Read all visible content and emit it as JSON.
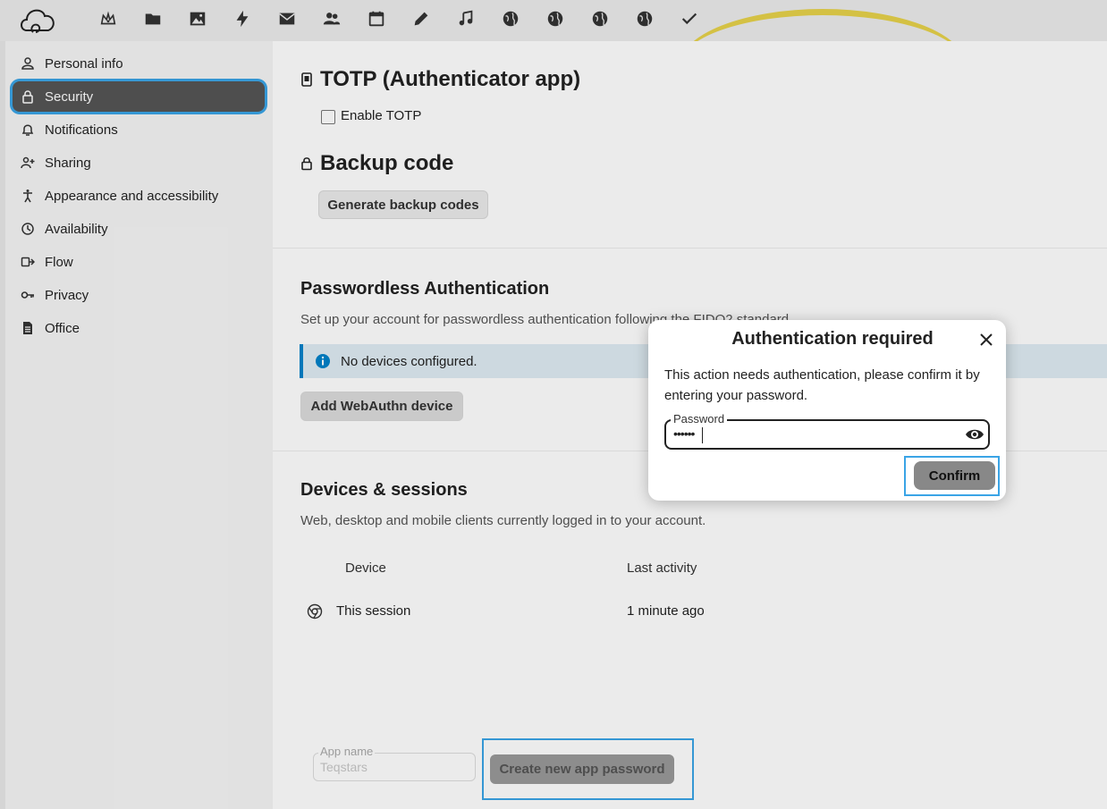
{
  "topbar": {
    "apps": [
      {
        "name": "dashboard-icon"
      },
      {
        "name": "files-icon"
      },
      {
        "name": "photos-icon"
      },
      {
        "name": "activity-icon"
      },
      {
        "name": "mail-icon"
      },
      {
        "name": "contacts-icon"
      },
      {
        "name": "calendar-icon"
      },
      {
        "name": "notes-icon"
      },
      {
        "name": "music-icon"
      },
      {
        "name": "globe-icon"
      },
      {
        "name": "globe-icon"
      },
      {
        "name": "globe-icon"
      },
      {
        "name": "globe-icon"
      },
      {
        "name": "tasks-check-icon"
      }
    ]
  },
  "sidebar": {
    "items": [
      {
        "label": "Personal info",
        "icon": "person-icon"
      },
      {
        "label": "Security",
        "icon": "lock-icon",
        "active": true
      },
      {
        "label": "Notifications",
        "icon": "bell-icon"
      },
      {
        "label": "Sharing",
        "icon": "share-person-icon"
      },
      {
        "label": "Appearance and accessibility",
        "icon": "accessibility-icon"
      },
      {
        "label": "Availability",
        "icon": "clock-icon"
      },
      {
        "label": "Flow",
        "icon": "flow-icon"
      },
      {
        "label": "Privacy",
        "icon": "key-icon"
      },
      {
        "label": "Office",
        "icon": "document-icon"
      }
    ]
  },
  "main": {
    "totp": {
      "title": "TOTP (Authenticator app)",
      "checkbox_label": "Enable TOTP"
    },
    "backup": {
      "title": "Backup code",
      "button": "Generate backup codes"
    },
    "passwordless": {
      "title": "Passwordless Authentication",
      "description": "Set up your account for passwordless authentication following the FIDO2 standard.",
      "info": "No devices configured.",
      "button": "Add WebAuthn device"
    },
    "devices": {
      "title": "Devices & sessions",
      "description": "Web, desktop and mobile clients currently logged in to your account.",
      "columns": [
        "Device",
        "Last activity"
      ],
      "rows": [
        {
          "device": "This session",
          "last_activity": "1 minute ago"
        }
      ]
    },
    "app_password": {
      "label": "App name",
      "placeholder": "Teqstars",
      "button": "Create new app password"
    }
  },
  "dialog": {
    "title": "Authentication required",
    "message": "This action needs authentication, please confirm it by entering your password.",
    "password_label": "Password",
    "password_value": "••••••",
    "confirm": "Confirm"
  },
  "colors": {
    "accent": "#3aa4e6",
    "primary": "#0082c9",
    "active_nav": "#555555"
  }
}
